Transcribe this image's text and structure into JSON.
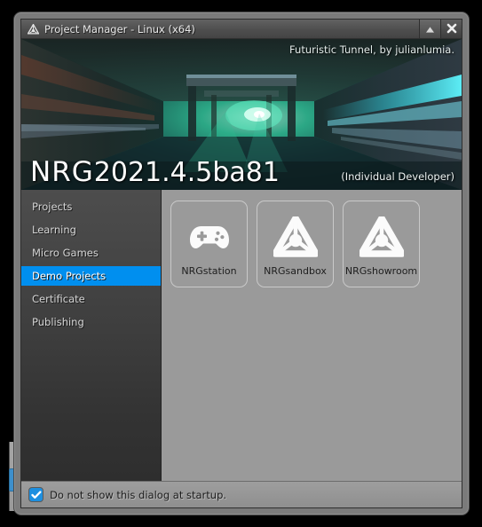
{
  "window": {
    "title": "Project Manager - Linux (x64)",
    "titlebar_icon": "nrg-logo-icon",
    "minimize_icon": "triangle-up-icon",
    "close_icon": "close-icon"
  },
  "banner": {
    "credit": "Futuristic Tunnel, by julianlumia.",
    "brand": "NRG",
    "version": "2021.4.5ba81",
    "developer": "(Individual Developer)"
  },
  "sidebar": {
    "items": [
      {
        "label": "Projects",
        "selected": false
      },
      {
        "label": "Learning",
        "selected": false
      },
      {
        "label": "Micro Games",
        "selected": false
      },
      {
        "label": "Demo Projects",
        "selected": true
      },
      {
        "label": "Certificate",
        "selected": false
      },
      {
        "label": "Publishing",
        "selected": false
      }
    ]
  },
  "content": {
    "tiles": [
      {
        "label": "NRGstation",
        "icon": "gamepad-icon"
      },
      {
        "label": "NRGsandbox",
        "icon": "nrg-logo-icon"
      },
      {
        "label": "NRGshowroom",
        "icon": "nrg-logo-icon"
      }
    ]
  },
  "footer": {
    "checkbox_label": "Do not show this dialog at startup.",
    "checkbox_checked": true,
    "checkbox_icon": "checkmark-icon"
  },
  "colors": {
    "selection_blue": "#008fef",
    "checkbox_blue": "#1d8fe0",
    "sidebar_top": "#4d4d4d",
    "content_gray": "#9a9a9a"
  }
}
